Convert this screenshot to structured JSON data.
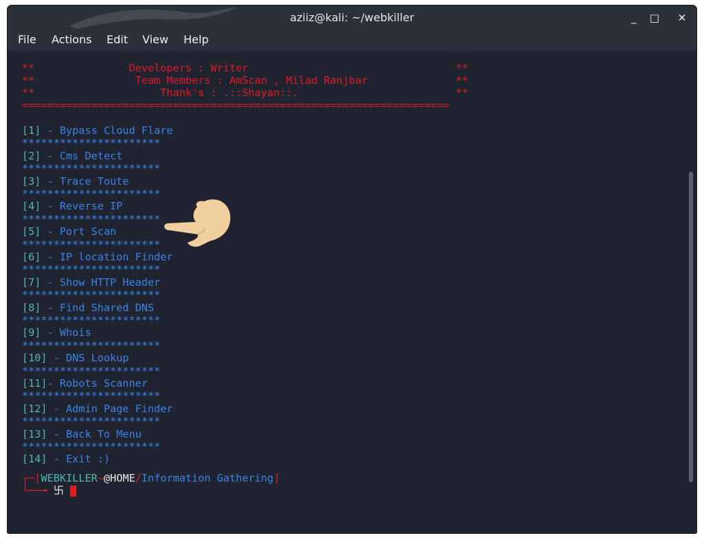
{
  "window": {
    "title": "aziiz@kali: ~/webkiller"
  },
  "window_controls": {
    "minimize": "_",
    "maximize": "□",
    "close": "✕"
  },
  "menu": [
    "File",
    "Actions",
    "Edit",
    "View",
    "Help"
  ],
  "banner": {
    "developers": "**               Developers : Writer                                 **",
    "team": "**                Team Members : AmScan , Milad Ranjbar              **",
    "thanks": "**                    Thank's : .::Shayan::.                         **",
    "rule": "===================================================================="
  },
  "options": [
    {
      "num": "[1]",
      "label": " - Bypass Cloud Flare"
    },
    {
      "num": "[2]",
      "label": " - Cms Detect"
    },
    {
      "num": "[3]",
      "label": " - Trace Toute"
    },
    {
      "num": "[4]",
      "label": " - Reverse IP"
    },
    {
      "num": "[5]",
      "label": " - Port Scan"
    },
    {
      "num": "[6]",
      "label": " - IP location Finder"
    },
    {
      "num": "[7]",
      "label": " - Show HTTP Header"
    },
    {
      "num": "[8]",
      "label": " - Find Shared DNS"
    },
    {
      "num": "[9]",
      "label": " - Whois"
    },
    {
      "num": "[10]",
      "label": " - DNS Lookup"
    },
    {
      "num": "[11]",
      "label": "- Robots Scanner"
    },
    {
      "num": "[12]",
      "label": " - Admin Page Finder"
    },
    {
      "num": "[13]",
      "label": " - Back To Menu"
    },
    {
      "num": "[14]",
      "label": " - Exit :)"
    }
  ],
  "separator": "**********************",
  "prompt": {
    "corner_top": "┌─",
    "lbracket": "[",
    "user": "WEBKILLER",
    "tilde": "~",
    "host": "@HOME",
    "slash": "/",
    "path": "Information Gathering",
    "rbracket": "]",
    "corner_bottom": "└──╼ ",
    "symbol": "卐 "
  },
  "colors": {
    "banner": "#e01b24",
    "option_number": "#4fb6b0",
    "option_label": "#3b83e6",
    "separator": "#3b83e6",
    "background": "#1f2430",
    "hand": "#f2cf9f"
  },
  "icons": {
    "pointing_hand": "backhand-index-pointing-left-emoji"
  }
}
